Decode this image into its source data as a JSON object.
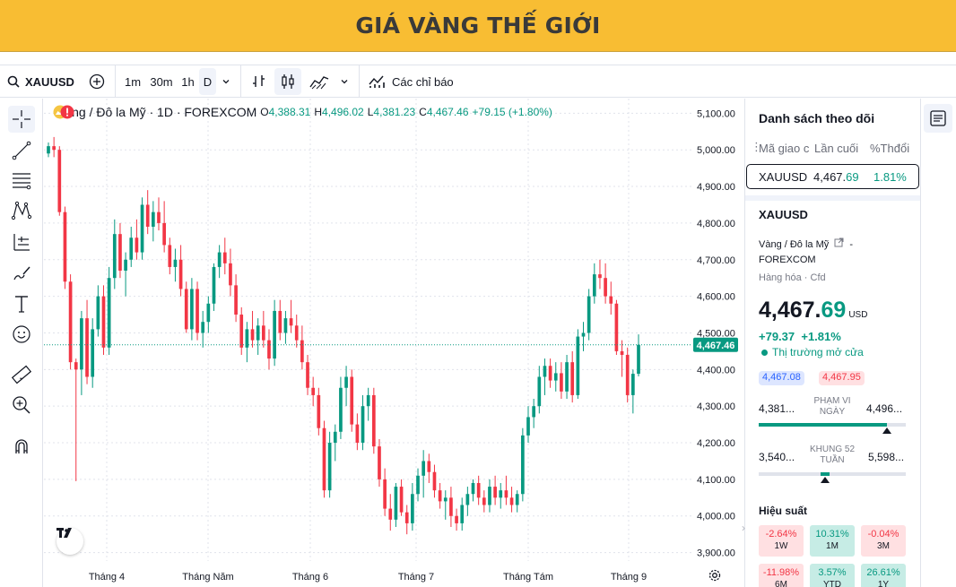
{
  "banner": {
    "title": "GIÁ VÀNG THẾ GIỚI"
  },
  "toolbar": {
    "symbol": "XAUUSD",
    "intervals": [
      "1m",
      "30m",
      "1h",
      "D"
    ],
    "indicators_label": "Các chỉ báo"
  },
  "legend": {
    "symbol_desc": "Vàng / Đô la Mỹ · 1D · FOREXCOM",
    "o_label": "O",
    "o_value": "4,388.31",
    "h_label": "H",
    "h_value": "4,496.02",
    "l_label": "L",
    "l_value": "4,381.23",
    "c_label": "C",
    "c_value": "4,467.46",
    "change": "+79.15 (+1.80%)"
  },
  "colors": {
    "up": "#089981",
    "down": "#f23645",
    "banner": "#f8bd33",
    "accent": "#2962ff"
  },
  "chart_data": {
    "type": "candlestick",
    "x_ticks": [
      "Tháng 4",
      "Tháng Năm",
      "Tháng 6",
      "Tháng 7",
      "Tháng Tám",
      "Tháng 9"
    ],
    "y_ticks": [
      "5,100.00",
      "5,000.00",
      "4,900.00",
      "4,800.00",
      "4,700.00",
      "4,600.00",
      "4,500.00",
      "4,400.00",
      "4,300.00",
      "4,200.00",
      "4,100.00",
      "4,000.00",
      "3,900.00"
    ],
    "ylim": [
      3877,
      5140
    ],
    "last_price_label": "4,467.46",
    "last_price": 4467.46,
    "grid": true,
    "series": [
      {
        "o": 4990,
        "h": 5020,
        "l": 4980,
        "c": 5010
      },
      {
        "o": 5010,
        "h": 5035,
        "l": 4980,
        "c": 5000
      },
      {
        "o": 5000,
        "h": 5010,
        "l": 4820,
        "c": 4830
      },
      {
        "o": 4830,
        "h": 4845,
        "l": 4620,
        "c": 4640
      },
      {
        "o": 4640,
        "h": 4660,
        "l": 4400,
        "c": 4420
      },
      {
        "o": 4420,
        "h": 4430,
        "l": 4095,
        "c": 4400
      },
      {
        "o": 4400,
        "h": 4560,
        "l": 4330,
        "c": 4540
      },
      {
        "o": 4540,
        "h": 4590,
        "l": 4360,
        "c": 4380
      },
      {
        "o": 4380,
        "h": 4540,
        "l": 4350,
        "c": 4510
      },
      {
        "o": 4510,
        "h": 4630,
        "l": 4490,
        "c": 4600
      },
      {
        "o": 4600,
        "h": 4630,
        "l": 4440,
        "c": 4460
      },
      {
        "o": 4460,
        "h": 4680,
        "l": 4440,
        "c": 4650
      },
      {
        "o": 4650,
        "h": 4810,
        "l": 4620,
        "c": 4770
      },
      {
        "o": 4770,
        "h": 4800,
        "l": 4650,
        "c": 4670
      },
      {
        "o": 4670,
        "h": 4720,
        "l": 4600,
        "c": 4700
      },
      {
        "o": 4700,
        "h": 4790,
        "l": 4680,
        "c": 4760
      },
      {
        "o": 4760,
        "h": 4810,
        "l": 4700,
        "c": 4720
      },
      {
        "o": 4720,
        "h": 4870,
        "l": 4700,
        "c": 4850
      },
      {
        "o": 4850,
        "h": 4890,
        "l": 4770,
        "c": 4790
      },
      {
        "o": 4790,
        "h": 4860,
        "l": 4750,
        "c": 4830
      },
      {
        "o": 4830,
        "h": 4870,
        "l": 4780,
        "c": 4800
      },
      {
        "o": 4800,
        "h": 4860,
        "l": 4720,
        "c": 4740
      },
      {
        "o": 4740,
        "h": 4760,
        "l": 4660,
        "c": 4680
      },
      {
        "o": 4680,
        "h": 4730,
        "l": 4640,
        "c": 4700
      },
      {
        "o": 4700,
        "h": 4740,
        "l": 4600,
        "c": 4620
      },
      {
        "o": 4620,
        "h": 4640,
        "l": 4500,
        "c": 4510
      },
      {
        "o": 4510,
        "h": 4650,
        "l": 4480,
        "c": 4620
      },
      {
        "o": 4620,
        "h": 4640,
        "l": 4480,
        "c": 4500
      },
      {
        "o": 4500,
        "h": 4560,
        "l": 4460,
        "c": 4530
      },
      {
        "o": 4530,
        "h": 4600,
        "l": 4500,
        "c": 4580
      },
      {
        "o": 4580,
        "h": 4690,
        "l": 4560,
        "c": 4680
      },
      {
        "o": 4680,
        "h": 4740,
        "l": 4650,
        "c": 4720
      },
      {
        "o": 4720,
        "h": 4760,
        "l": 4660,
        "c": 4690
      },
      {
        "o": 4690,
        "h": 4730,
        "l": 4600,
        "c": 4630
      },
      {
        "o": 4630,
        "h": 4660,
        "l": 4530,
        "c": 4550
      },
      {
        "o": 4550,
        "h": 4570,
        "l": 4440,
        "c": 4460
      },
      {
        "o": 4460,
        "h": 4530,
        "l": 4420,
        "c": 4510
      },
      {
        "o": 4510,
        "h": 4560,
        "l": 4460,
        "c": 4480
      },
      {
        "o": 4480,
        "h": 4540,
        "l": 4440,
        "c": 4520
      },
      {
        "o": 4520,
        "h": 4560,
        "l": 4460,
        "c": 4480
      },
      {
        "o": 4480,
        "h": 4510,
        "l": 4400,
        "c": 4430
      },
      {
        "o": 4430,
        "h": 4590,
        "l": 4410,
        "c": 4560
      },
      {
        "o": 4560,
        "h": 4590,
        "l": 4480,
        "c": 4500
      },
      {
        "o": 4500,
        "h": 4560,
        "l": 4470,
        "c": 4540
      },
      {
        "o": 4540,
        "h": 4590,
        "l": 4500,
        "c": 4520
      },
      {
        "o": 4520,
        "h": 4550,
        "l": 4460,
        "c": 4480
      },
      {
        "o": 4480,
        "h": 4520,
        "l": 4400,
        "c": 4420
      },
      {
        "o": 4420,
        "h": 4440,
        "l": 4330,
        "c": 4350
      },
      {
        "o": 4350,
        "h": 4380,
        "l": 4300,
        "c": 4330
      },
      {
        "o": 4330,
        "h": 4350,
        "l": 4220,
        "c": 4240
      },
      {
        "o": 4240,
        "h": 4260,
        "l": 4050,
        "c": 4070
      },
      {
        "o": 4070,
        "h": 4230,
        "l": 4050,
        "c": 4200
      },
      {
        "o": 4200,
        "h": 4250,
        "l": 4150,
        "c": 4230
      },
      {
        "o": 4230,
        "h": 4380,
        "l": 4210,
        "c": 4350
      },
      {
        "o": 4350,
        "h": 4410,
        "l": 4300,
        "c": 4380
      },
      {
        "o": 4380,
        "h": 4400,
        "l": 4230,
        "c": 4250
      },
      {
        "o": 4250,
        "h": 4280,
        "l": 4180,
        "c": 4200
      },
      {
        "o": 4200,
        "h": 4330,
        "l": 4180,
        "c": 4300
      },
      {
        "o": 4300,
        "h": 4350,
        "l": 4260,
        "c": 4330
      },
      {
        "o": 4330,
        "h": 4350,
        "l": 4170,
        "c": 4190
      },
      {
        "o": 4190,
        "h": 4210,
        "l": 4080,
        "c": 4100
      },
      {
        "o": 4100,
        "h": 4130,
        "l": 4000,
        "c": 4020
      },
      {
        "o": 4020,
        "h": 4060,
        "l": 3960,
        "c": 3990
      },
      {
        "o": 3990,
        "h": 4090,
        "l": 3970,
        "c": 4080
      },
      {
        "o": 4080,
        "h": 4100,
        "l": 4000,
        "c": 4010
      },
      {
        "o": 4010,
        "h": 4030,
        "l": 3950,
        "c": 3980
      },
      {
        "o": 3980,
        "h": 4090,
        "l": 3960,
        "c": 4060
      },
      {
        "o": 4060,
        "h": 4130,
        "l": 4040,
        "c": 4110
      },
      {
        "o": 4110,
        "h": 4180,
        "l": 4050,
        "c": 4150
      },
      {
        "o": 4150,
        "h": 4170,
        "l": 4090,
        "c": 4120
      },
      {
        "o": 4120,
        "h": 4140,
        "l": 4050,
        "c": 4070
      },
      {
        "o": 4070,
        "h": 4090,
        "l": 4020,
        "c": 4040
      },
      {
        "o": 4040,
        "h": 4070,
        "l": 3990,
        "c": 4050
      },
      {
        "o": 4050,
        "h": 4080,
        "l": 3970,
        "c": 4000
      },
      {
        "o": 4000,
        "h": 4020,
        "l": 3960,
        "c": 3980
      },
      {
        "o": 3980,
        "h": 4050,
        "l": 3960,
        "c": 4030
      },
      {
        "o": 4030,
        "h": 4080,
        "l": 4000,
        "c": 4060
      },
      {
        "o": 4060,
        "h": 4100,
        "l": 4040,
        "c": 4090
      },
      {
        "o": 4090,
        "h": 4110,
        "l": 4030,
        "c": 4050
      },
      {
        "o": 4050,
        "h": 4070,
        "l": 4010,
        "c": 4030
      },
      {
        "o": 4030,
        "h": 4100,
        "l": 4010,
        "c": 4080
      },
      {
        "o": 4080,
        "h": 4110,
        "l": 4030,
        "c": 4050
      },
      {
        "o": 4050,
        "h": 4090,
        "l": 4020,
        "c": 4070
      },
      {
        "o": 4070,
        "h": 4110,
        "l": 4030,
        "c": 4050
      },
      {
        "o": 4050,
        "h": 4080,
        "l": 4010,
        "c": 4030
      },
      {
        "o": 4030,
        "h": 4070,
        "l": 4010,
        "c": 4060
      },
      {
        "o": 4060,
        "h": 4240,
        "l": 4040,
        "c": 4220
      },
      {
        "o": 4220,
        "h": 4300,
        "l": 4200,
        "c": 4270
      },
      {
        "o": 4270,
        "h": 4320,
        "l": 4240,
        "c": 4300
      },
      {
        "o": 4300,
        "h": 4410,
        "l": 4280,
        "c": 4380
      },
      {
        "o": 4380,
        "h": 4430,
        "l": 4330,
        "c": 4410
      },
      {
        "o": 4410,
        "h": 4430,
        "l": 4350,
        "c": 4370
      },
      {
        "o": 4370,
        "h": 4420,
        "l": 4340,
        "c": 4390
      },
      {
        "o": 4390,
        "h": 4420,
        "l": 4320,
        "c": 4340
      },
      {
        "o": 4340,
        "h": 4440,
        "l": 4320,
        "c": 4420
      },
      {
        "o": 4420,
        "h": 4450,
        "l": 4310,
        "c": 4330
      },
      {
        "o": 4330,
        "h": 4510,
        "l": 4320,
        "c": 4490
      },
      {
        "o": 4490,
        "h": 4530,
        "l": 4450,
        "c": 4500
      },
      {
        "o": 4500,
        "h": 4620,
        "l": 4480,
        "c": 4600
      },
      {
        "o": 4600,
        "h": 4690,
        "l": 4580,
        "c": 4660
      },
      {
        "o": 4660,
        "h": 4700,
        "l": 4620,
        "c": 4650
      },
      {
        "o": 4650,
        "h": 4690,
        "l": 4580,
        "c": 4600
      },
      {
        "o": 4600,
        "h": 4640,
        "l": 4550,
        "c": 4580
      },
      {
        "o": 4580,
        "h": 4590,
        "l": 4440,
        "c": 4450
      },
      {
        "o": 4450,
        "h": 4480,
        "l": 4380,
        "c": 4440
      },
      {
        "o": 4440,
        "h": 4460,
        "l": 4310,
        "c": 4330
      },
      {
        "o": 4330,
        "h": 4400,
        "l": 4280,
        "c": 4388.31
      },
      {
        "o": 4388.31,
        "h": 4496.02,
        "l": 4381.23,
        "c": 4467.46
      }
    ]
  },
  "watchlist": {
    "title": "Danh sách theo dõi",
    "columns": [
      "Mã giao c",
      "Lần cuối",
      "%Thđổi"
    ],
    "row": {
      "symbol": "XAUUSD",
      "last_main": "4,467.",
      "last_tail": "69",
      "change": "1.81%"
    }
  },
  "details": {
    "symbol": "XAUUSD",
    "desc": "Vàng / Đô la Mỹ",
    "exchange_suffix": "-",
    "exchange": "FOREXCOM",
    "type_a": "Hàng hóa",
    "type_b": "Cfd",
    "price_main": "4,467.",
    "price_tail": "69",
    "currency": "USD",
    "change_abs": "+79.37",
    "change_pct": "+1.81%",
    "market_status": "Thị trường mở cửa",
    "bid": "4,467.08",
    "ask": "4,467.95",
    "day_low": "4,381...",
    "day_high": "4,496...",
    "day_range_label": "PHẠM VI NGÀY",
    "day_range_pos": 0.87,
    "wk52_low": "3,540...",
    "wk52_high": "5,598...",
    "wk52_label": "KHUNG 52 TUẦN",
    "wk52_pos": 0.45,
    "perf_title": "Hiệu suất",
    "perf": [
      {
        "value": "-2.64%",
        "label": "1W",
        "dir": "down"
      },
      {
        "value": "10.31%",
        "label": "1M",
        "dir": "up"
      },
      {
        "value": "-0.04%",
        "label": "3M",
        "dir": "down"
      },
      {
        "value": "-11.98%",
        "label": "6M",
        "dir": "down"
      },
      {
        "value": "3.57%",
        "label": "YTD",
        "dir": "up"
      },
      {
        "value": "26.61%",
        "label": "1Y",
        "dir": "up"
      }
    ]
  }
}
